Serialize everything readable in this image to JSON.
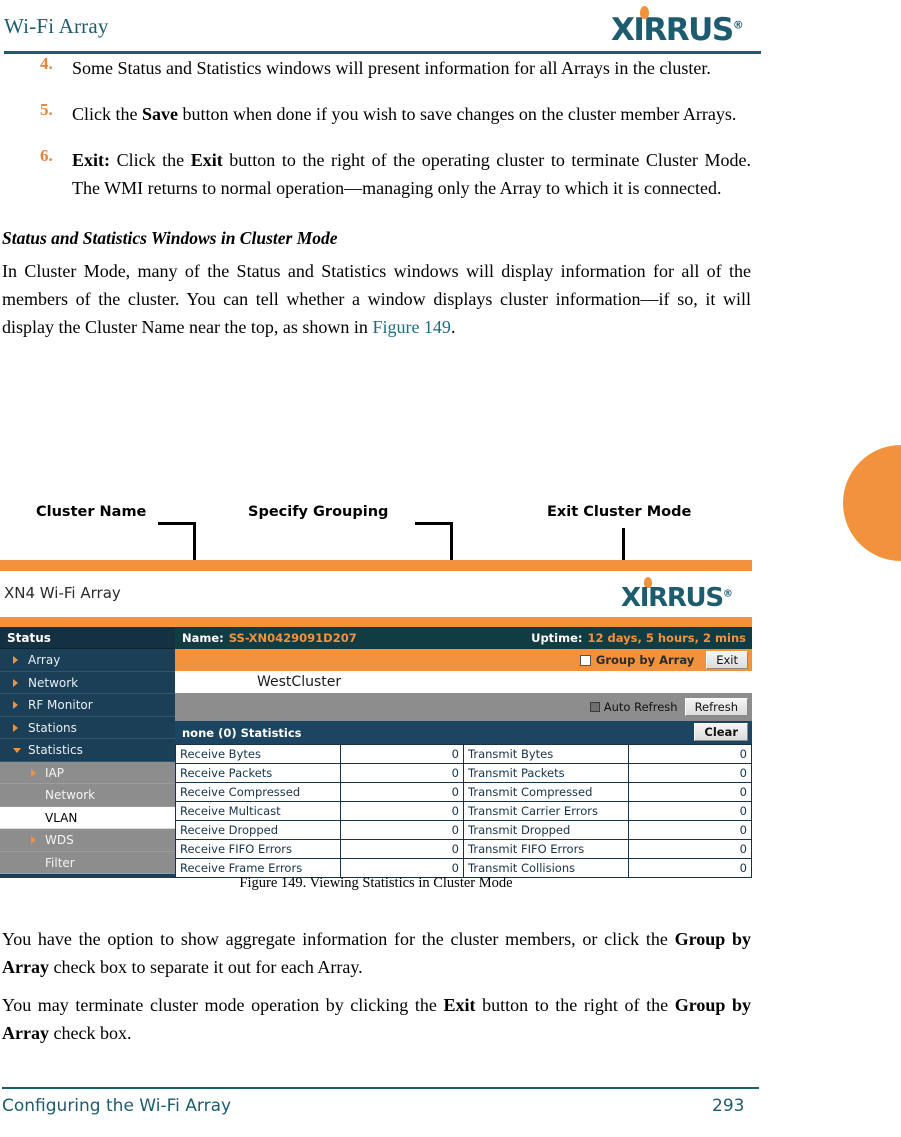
{
  "header": {
    "title": "Wi-Fi Array",
    "logo": "xirrus-logo",
    "logo_text": "XIRRUS",
    "logo_registered": "®"
  },
  "steps": [
    {
      "number": "4.",
      "segments": [
        {
          "text": "Some Status and Statistics windows will present information for all Arrays in the cluster.",
          "bold": false
        }
      ]
    },
    {
      "number": "5.",
      "segments": [
        {
          "text": "Click the ",
          "bold": false
        },
        {
          "text": "Save",
          "bold": true
        },
        {
          "text": " button when done if you wish to save changes on the cluster member Arrays.",
          "bold": false
        }
      ]
    },
    {
      "number": "6.",
      "segments": [
        {
          "text": "Exit:",
          "bold": true
        },
        {
          "text": " Click the ",
          "bold": false
        },
        {
          "text": "Exit",
          "bold": true
        },
        {
          "text": " button to the right of the operating cluster to terminate Cluster Mode. The WMI returns to normal operation—managing only the Array to which it is connected.",
          "bold": false
        }
      ]
    }
  ],
  "subhead": "Status and Statistics Windows in Cluster Mode",
  "intro_paragraph": {
    "before_ref": "In Cluster Mode, many of the Status and Statistics windows will display information for all of the members of the cluster. You can tell whether a window displays cluster information—if so, it will display the Cluster Name near the top, as shown in ",
    "ref": "Figure 149",
    "after_ref": "."
  },
  "callouts": [
    {
      "label": "Cluster Name"
    },
    {
      "label": "Specify Grouping"
    },
    {
      "label": "Exit Cluster Mode"
    }
  ],
  "figure": {
    "caption": "Figure 149. Viewing Statistics in Cluster Mode",
    "brand_title": "XN4 Wi-Fi Array",
    "logo_text": "XIRRUS",
    "logo_registered": "®",
    "sidebar": {
      "header": "Status",
      "items": [
        {
          "label": "Array",
          "level": 1,
          "caret": "right",
          "style": "dark"
        },
        {
          "label": "Network",
          "level": 1,
          "caret": "right",
          "style": "dark"
        },
        {
          "label": "RF Monitor",
          "level": 1,
          "caret": "right",
          "style": "dark"
        },
        {
          "label": "Stations",
          "level": 1,
          "caret": "right",
          "style": "dark"
        },
        {
          "label": "Statistics",
          "level": 1,
          "caret": "down",
          "style": "dark"
        },
        {
          "label": "IAP",
          "level": 2,
          "caret": "right",
          "style": "grey"
        },
        {
          "label": "Network",
          "level": 2,
          "caret": "none",
          "style": "grey"
        },
        {
          "label": "VLAN",
          "level": 2,
          "caret": "none",
          "style": "white"
        },
        {
          "label": "WDS",
          "level": 2,
          "caret": "right",
          "style": "grey"
        },
        {
          "label": "Filter",
          "level": 2,
          "caret": "none",
          "style": "grey"
        }
      ]
    },
    "statusbar": {
      "name_label": "Name:",
      "name_value": "SS-XN0429091D207",
      "uptime_label": "Uptime:",
      "uptime_value": "12 days, 5 hours, 2 mins"
    },
    "toolbar": {
      "group_by_array_label": "Group by Array",
      "group_by_array_checked": false,
      "exit_label": "Exit"
    },
    "cluster_name": "WestCluster",
    "refresh_bar": {
      "auto_refresh_label": "Auto Refresh",
      "auto_refresh_checked": false,
      "refresh_label": "Refresh"
    },
    "panel_title": "none (0) Statistics",
    "clear_label": "Clear",
    "stats_rows": [
      {
        "rx_key": "Receive Bytes",
        "rx_val": "0",
        "tx_key": "Transmit Bytes",
        "tx_val": "0"
      },
      {
        "rx_key": "Receive Packets",
        "rx_val": "0",
        "tx_key": "Transmit Packets",
        "tx_val": "0"
      },
      {
        "rx_key": "Receive Compressed",
        "rx_val": "0",
        "tx_key": "Transmit Compressed",
        "tx_val": "0"
      },
      {
        "rx_key": "Receive Multicast",
        "rx_val": "0",
        "tx_key": "Transmit Carrier Errors",
        "tx_val": "0"
      },
      {
        "rx_key": "Receive Dropped",
        "rx_val": "0",
        "tx_key": "Transmit Dropped",
        "tx_val": "0"
      },
      {
        "rx_key": "Receive FIFO Errors",
        "rx_val": "0",
        "tx_key": "Transmit FIFO Errors",
        "tx_val": "0"
      },
      {
        "rx_key": "Receive Frame Errors",
        "rx_val": "0",
        "tx_key": "Transmit Collisions",
        "tx_val": "0"
      }
    ]
  },
  "closing_paragraphs": [
    [
      {
        "text": "You have the option to show aggregate information for the cluster members, or click the ",
        "bold": false
      },
      {
        "text": "Group by Array",
        "bold": true
      },
      {
        "text": " check box to separate it out for each Array.",
        "bold": false
      }
    ],
    [
      {
        "text": "You may terminate cluster mode operation by clicking the ",
        "bold": false
      },
      {
        "text": "Exit",
        "bold": true
      },
      {
        "text": " button to the right of the ",
        "bold": false
      },
      {
        "text": "Group by Array",
        "bold": true
      },
      {
        "text": " check box.",
        "bold": false
      }
    ]
  ],
  "footer": {
    "left": "Configuring the Wi-Fi Array",
    "page": "293"
  },
  "colors": {
    "brand_teal": "#1d5c6e",
    "accent_orange": "#f2923c",
    "panel_dark": "#1b3f57",
    "statusbar_dark": "#123c44",
    "title_blue": "#1b4560",
    "grey": "#8d8d8d"
  }
}
